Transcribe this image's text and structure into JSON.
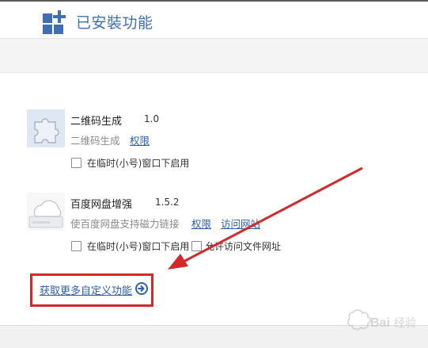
{
  "header": {
    "title": "已安裝功能"
  },
  "extensions": [
    {
      "name": "二维码生成",
      "version": "1.0",
      "description": "二维码生成",
      "links": [
        "权限"
      ],
      "checkboxes": [
        {
          "label": "在临时(小号)窗口下启用",
          "checked": false
        }
      ]
    },
    {
      "name": "百度网盘增强",
      "version": "1.5.2",
      "description": "使百度网盘支持磁力链接",
      "links": [
        "权限",
        "访问网站"
      ],
      "checkboxes": [
        {
          "label": "在临时(小号)窗口下启用",
          "checked": false
        },
        {
          "label": "允许访问文件网址",
          "checked": false
        }
      ]
    }
  ],
  "more_link": {
    "label": "获取更多自定义功能"
  },
  "icons": {
    "header": "grid-plus-icon",
    "extension_1": "puzzle-icon",
    "extension_2": "cloud-drive-icon",
    "more": "arrow-right-circle-icon"
  },
  "colors": {
    "title": "#3d6fb6",
    "link": "#2b5fb0",
    "highlight": "#d22a2a",
    "muted": "#8a8a8a"
  },
  "watermark": {
    "text": "Bai du 经验"
  }
}
